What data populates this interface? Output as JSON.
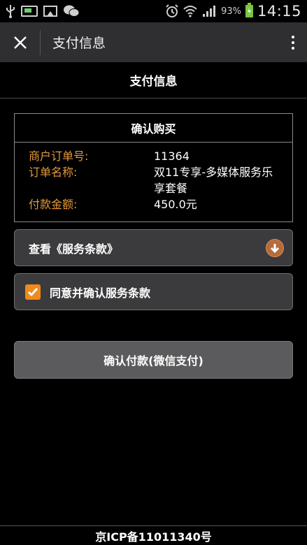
{
  "status_bar": {
    "icons": [
      "usb-icon",
      "sim-icon",
      "gallery-icon",
      "wechat-icon",
      "alarm-icon",
      "wifi-icon",
      "signal-icon",
      "battery-icon"
    ],
    "battery_percent": "93%",
    "time": "14:15"
  },
  "app_bar": {
    "title": "支付信息"
  },
  "page": {
    "header": "支付信息"
  },
  "order": {
    "title": "确认购买",
    "rows": [
      {
        "label": "商户订单号:",
        "value": "11364"
      },
      {
        "label": "订单名称:",
        "value": "双11专享-多媒体服务乐享套餐"
      },
      {
        "label": "付款金额:",
        "value": "450.0元"
      }
    ]
  },
  "terms": {
    "label": "查看《服务条款》"
  },
  "agree": {
    "label": "同意并确认服务条款",
    "checked": true
  },
  "pay": {
    "label": "确认付款(微信支付)"
  },
  "footer": {
    "text": "京ICP备11011340号"
  },
  "colors": {
    "accent_orange": "#e59a3a",
    "checkbox_orange": "#f08a1c",
    "battery_green": "#79c542"
  }
}
